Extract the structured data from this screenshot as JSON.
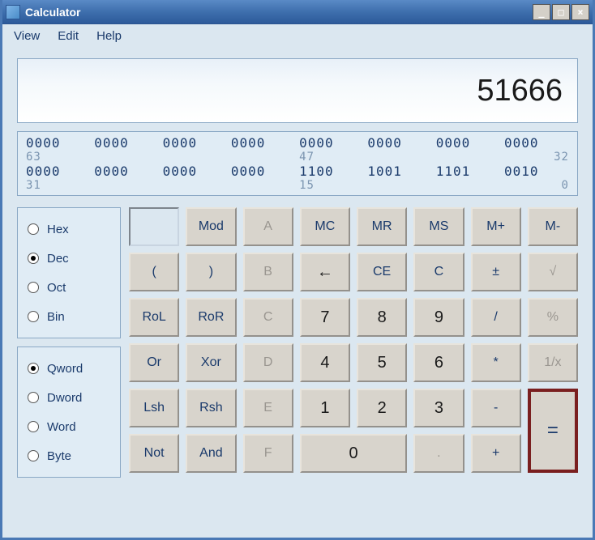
{
  "window": {
    "title": "Calculator"
  },
  "titlebar_buttons": {
    "minimize": "_",
    "maximize": "□",
    "close": "×"
  },
  "menu": {
    "view": "View",
    "edit": "Edit",
    "help": "Help"
  },
  "display_value": "51666",
  "bits": {
    "row1": [
      "0000",
      "0000",
      "0000",
      "0000",
      "0000",
      "0000",
      "0000",
      "0000"
    ],
    "row1_idx": [
      "63",
      "",
      "",
      "",
      "47",
      "",
      "",
      "32"
    ],
    "row2": [
      "0000",
      "0000",
      "0000",
      "0000",
      "1100",
      "1001",
      "1101",
      "0010"
    ],
    "row2_idx": [
      "31",
      "",
      "",
      "",
      "15",
      "",
      "",
      "0"
    ]
  },
  "base": {
    "hex": "Hex",
    "dec": "Dec",
    "oct": "Oct",
    "bin": "Bin",
    "selected": "dec"
  },
  "word": {
    "qword": "Qword",
    "dword": "Dword",
    "word": "Word",
    "byte": "Byte",
    "selected": "qword"
  },
  "keys": {
    "mod": "Mod",
    "a": "A",
    "mc": "MC",
    "mr": "MR",
    "ms": "MS",
    "mplus": "M+",
    "mminus": "M-",
    "lp": "(",
    "rp": ")",
    "b": "B",
    "back": "←",
    "ce": "CE",
    "c": "C",
    "pm": "±",
    "sqrt": "√",
    "rol": "RoL",
    "ror": "RoR",
    "cc": "C",
    "7": "7",
    "8": "8",
    "9": "9",
    "div": "/",
    "pct": "%",
    "or": "Or",
    "xor": "Xor",
    "d": "D",
    "4": "4",
    "5": "5",
    "6": "6",
    "mul": "*",
    "inv": "1/x",
    "lsh": "Lsh",
    "rsh": "Rsh",
    "e": "E",
    "1": "1",
    "2": "2",
    "3": "3",
    "sub": "-",
    "not": "Not",
    "and": "And",
    "f": "F",
    "0": "0",
    "dot": ".",
    "add": "+",
    "eq": "="
  }
}
